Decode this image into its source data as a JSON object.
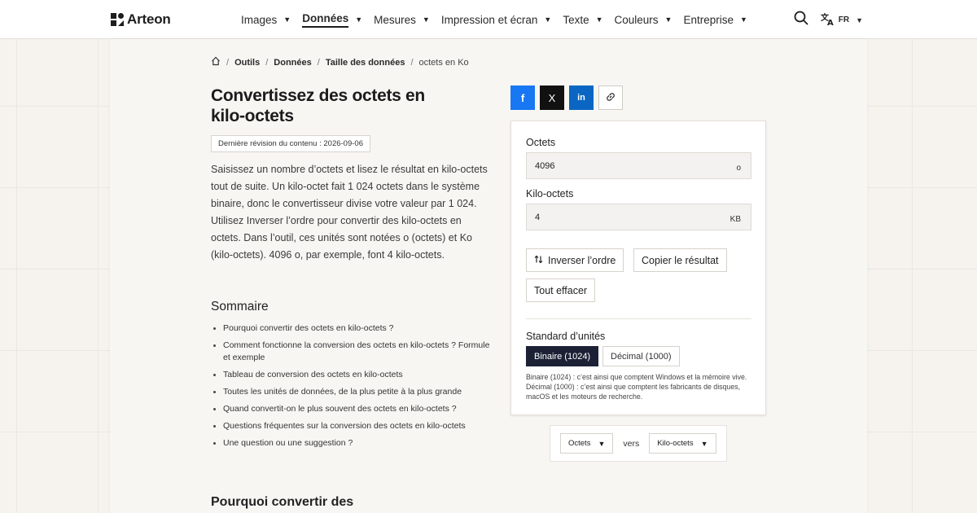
{
  "app": {
    "brand": "Arteon"
  },
  "nav": {
    "items": [
      {
        "label": "Images",
        "active": false
      },
      {
        "label": "Données",
        "active": true
      },
      {
        "label": "Mesures",
        "active": false
      },
      {
        "label": "Impression et écran",
        "active": false
      },
      {
        "label": "Texte",
        "active": false
      },
      {
        "label": "Couleurs",
        "active": false
      },
      {
        "label": "Entreprise",
        "active": false
      }
    ],
    "language": "FR"
  },
  "breadcrumb": {
    "items": [
      "Outils",
      "Données",
      "Taille des données"
    ],
    "current": "octets en Ko"
  },
  "page": {
    "title": "Convertissez des octets en kilo-octets",
    "revised": "Dernière révision du contenu : 2026-09-06",
    "intro": "Saisissez un nombre d’octets et lisez le résultat en kilo-octets tout de suite. Un kilo-octet fait 1 024 octets dans le système binaire, donc le convertisseur divise votre valeur par 1 024. Utilisez Inverser l’ordre pour convertir des kilo-octets en octets. Dans l’outil, ces unités sont notées o (octets) et Ko (kilo-octets). 4096 o, par exemple, font 4 kilo-octets.",
    "toc_title": "Sommaire",
    "toc": [
      "Pourquoi convertir des octets en kilo-octets ?",
      "Comment fonctionne la conversion des octets en kilo-octets ? Formule et exemple",
      "Tableau de conversion des octets en kilo-octets",
      "Toutes les unités de données, de la plus petite à la plus grande",
      "Quand convertit-on le plus souvent des octets en kilo-octets ?",
      "Questions fréquentes sur la conversion des octets en kilo-octets",
      "Une question ou une suggestion ?"
    ],
    "section_heading": "Pourquoi convertir des"
  },
  "share": {
    "facebook": "f",
    "x": "X",
    "linkedin": "in"
  },
  "converter": {
    "from_label": "Octets",
    "from_value": "4096",
    "from_unit": "o",
    "to_label": "Kilo-octets",
    "to_value": "4",
    "to_unit": "KB",
    "swap_label": "Inverser l’ordre",
    "copy_label": "Copier le résultat",
    "clear_label": "Tout effacer",
    "standard_label": "Standard d’unités",
    "binary_label": "Binaire (1024)",
    "decimal_label": "Décimal (1000)",
    "selected_standard": "Binaire (1024)",
    "note": "Binaire (1024) : c’est ainsi que comptent Windows et la mémoire vive. Décimal (1000) : c’est ainsi que comptent les fabricants de disques, macOS et les moteurs de recherche."
  },
  "unit_pair": {
    "from": "Octets",
    "connector": "vers",
    "to": "Kilo-octets"
  }
}
